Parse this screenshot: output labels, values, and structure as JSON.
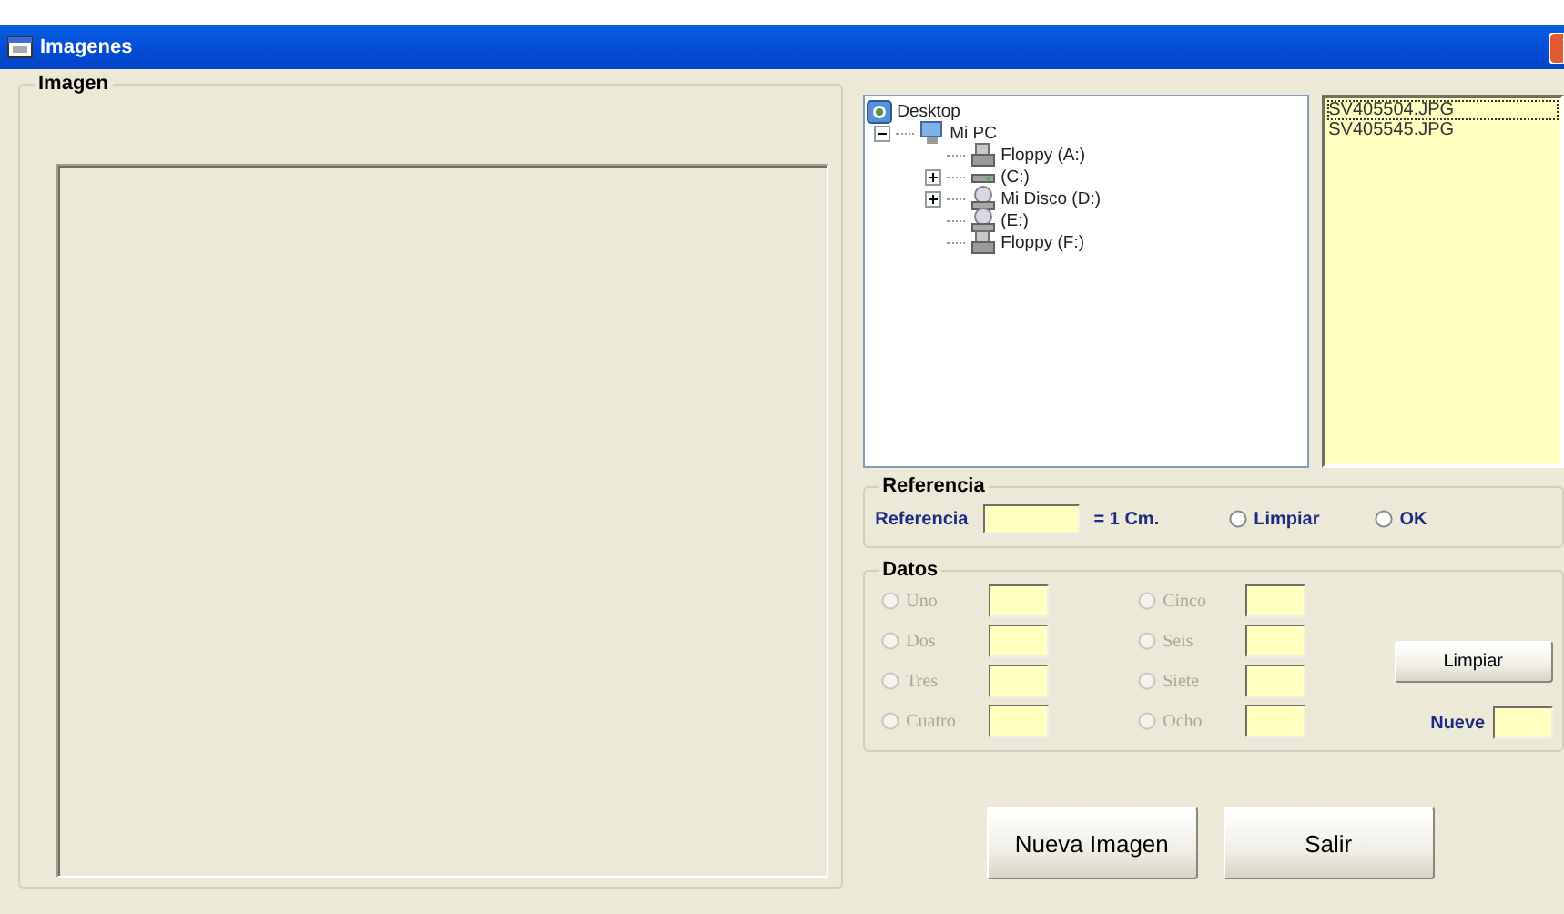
{
  "window": {
    "title": "Imagenes"
  },
  "image_group": {
    "title": "Imagen"
  },
  "tree": {
    "items": [
      {
        "label": "Desktop",
        "kind": "desktop",
        "children": [
          {
            "label": "Mi PC",
            "kind": "computer",
            "expanded": true,
            "children": [
              {
                "label": "Floppy (A:)",
                "kind": "floppy"
              },
              {
                "label": "(C:)",
                "kind": "drive",
                "expanded": false
              },
              {
                "label": "Mi Disco (D:)",
                "kind": "cd",
                "expanded": false
              },
              {
                "label": "(E:)",
                "kind": "cd"
              },
              {
                "label": "Floppy (F:)",
                "kind": "floppy"
              }
            ]
          }
        ]
      }
    ]
  },
  "files": {
    "items": [
      {
        "name": "SV405504.JPG",
        "selected": true
      },
      {
        "name": "SV405545.JPG",
        "selected": false
      }
    ]
  },
  "referencia": {
    "title": "Referencia",
    "label": "Referencia",
    "unit": "= 1 Cm.",
    "options": [
      {
        "label": "Limpiar",
        "checked": false
      },
      {
        "label": "OK",
        "checked": false
      }
    ]
  },
  "datos": {
    "title": "Datos",
    "items": [
      {
        "label": "Uno",
        "checked": false,
        "disabled": true
      },
      {
        "label": "Dos",
        "checked": false,
        "disabled": true
      },
      {
        "label": "Tres",
        "checked": false,
        "disabled": true
      },
      {
        "label": "Cuatro",
        "checked": false,
        "disabled": true
      },
      {
        "label": "Cinco",
        "checked": false,
        "disabled": true
      },
      {
        "label": "Seis",
        "checked": false,
        "disabled": true
      },
      {
        "label": "Siete",
        "checked": false,
        "disabled": true
      },
      {
        "label": "Ocho",
        "checked": false,
        "disabled": true
      }
    ],
    "clear_button": "Limpiar",
    "nueve_label": "Nueve"
  },
  "buttons": [
    "Nueva Imagen",
    "Salir"
  ]
}
